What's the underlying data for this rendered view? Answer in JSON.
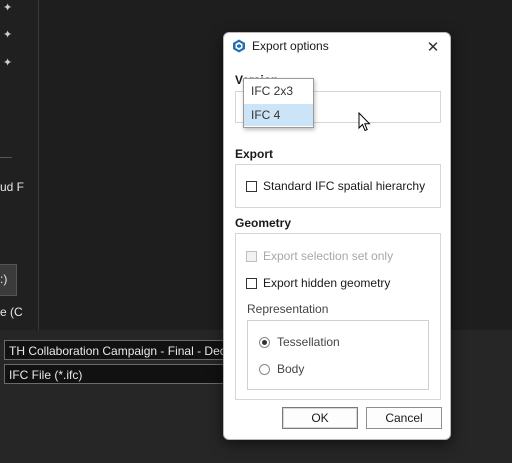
{
  "background": {
    "left_texts": [
      "ud F",
      ":)",
      "e (C"
    ],
    "name_field": "TH Collaboration Campaign - Final - Deco",
    "type_field": "IFC File (*.ifc)"
  },
  "dialog": {
    "title": "Export options",
    "version": {
      "label": "Version",
      "options": [
        "IFC 2x3",
        "IFC 4"
      ],
      "selected": "IFC 4"
    },
    "export": {
      "label": "Export",
      "standard_hierarchy": {
        "label": "Standard IFC spatial hierarchy",
        "checked": false
      }
    },
    "geometry": {
      "label": "Geometry",
      "selection_set_only": {
        "label": "Export selection set only",
        "checked": false,
        "enabled": false
      },
      "hidden_geometry": {
        "label": "Export hidden geometry",
        "checked": false
      },
      "representation": {
        "label": "Representation",
        "options": [
          {
            "label": "Tessellation",
            "selected": true
          },
          {
            "label": "Body",
            "selected": false
          }
        ]
      }
    },
    "buttons": {
      "ok": "OK",
      "cancel": "Cancel"
    }
  },
  "colors": {
    "app_background": "#1c1c1c",
    "dialog_background": "#ffffff",
    "dropdown_highlight": "#cce4f7",
    "sketchup_icon": "#1f6fb5"
  }
}
